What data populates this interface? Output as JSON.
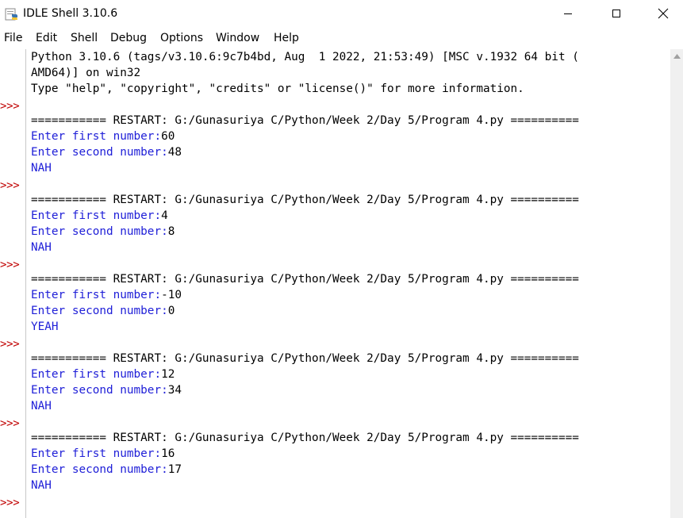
{
  "window": {
    "title": "IDLE Shell 3.10.6",
    "icons": {
      "app": "python-idle-icon",
      "minimize": "minimize-icon",
      "maximize": "maximize-icon",
      "close": "close-icon"
    }
  },
  "menu": {
    "items": [
      "File",
      "Edit",
      "Shell",
      "Debug",
      "Options",
      "Window",
      "Help"
    ]
  },
  "gutter": {
    "prompt": ">>>"
  },
  "shell": {
    "banner": [
      "Python 3.10.6 (tags/v3.10.6:9c7b4bd, Aug  1 2022, 21:53:49) [MSC v.1932 64 bit (",
      "AMD64)] on win32",
      "Type \"help\", \"copyright\", \"credits\" or \"license()\" for more information."
    ],
    "sessions": [
      {
        "restart": "=========== RESTART: G:/Gunasuriya C/Python/Week 2/Day 5/Program 4.py ==========",
        "first_prompt": "Enter first number:",
        "first_value": "60",
        "second_prompt": "Enter second number:",
        "second_value": "48",
        "output": "NAH"
      },
      {
        "restart": "=========== RESTART: G:/Gunasuriya C/Python/Week 2/Day 5/Program 4.py ==========",
        "first_prompt": "Enter first number:",
        "first_value": "4",
        "second_prompt": "Enter second number:",
        "second_value": "8",
        "output": "NAH"
      },
      {
        "restart": "=========== RESTART: G:/Gunasuriya C/Python/Week 2/Day 5/Program 4.py ==========",
        "first_prompt": "Enter first number:",
        "first_value": "-10",
        "second_prompt": "Enter second number:",
        "second_value": "0",
        "output": "YEAH"
      },
      {
        "restart": "=========== RESTART: G:/Gunasuriya C/Python/Week 2/Day 5/Program 4.py ==========",
        "first_prompt": "Enter first number:",
        "first_value": "12",
        "second_prompt": "Enter second number:",
        "second_value": "34",
        "output": "NAH"
      },
      {
        "restart": "=========== RESTART: G:/Gunasuriya C/Python/Week 2/Day 5/Program 4.py ==========",
        "first_prompt": "Enter first number:",
        "first_value": "16",
        "second_prompt": "Enter second number:",
        "second_value": "17",
        "output": "NAH"
      }
    ]
  },
  "colors": {
    "prompt": "#c00000",
    "stdout": "#2020d8",
    "text": "#000000"
  }
}
